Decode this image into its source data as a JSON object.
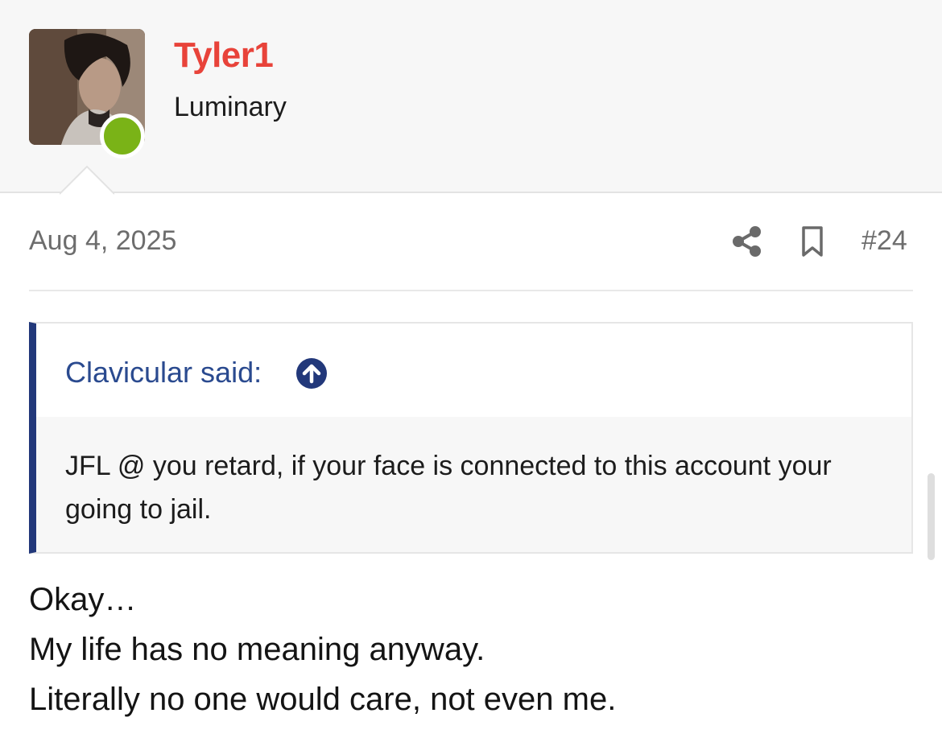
{
  "user": {
    "name": "Tyler1",
    "title": "Luminary",
    "name_color": "#e8433a",
    "online": true,
    "online_color": "#7ab317"
  },
  "post": {
    "date": "Aug 4, 2025",
    "number": "#24",
    "actions": [
      "share-icon",
      "bookmark-icon"
    ],
    "quote": {
      "author": "Clavicular said:",
      "text": "JFL @ you retard, if your face is connected to this account your going to jail.",
      "accent_color": "#22387a"
    },
    "body_lines": [
      "Okay…",
      "My life has no meaning anyway.",
      "Literally no one would care, not even me."
    ]
  }
}
